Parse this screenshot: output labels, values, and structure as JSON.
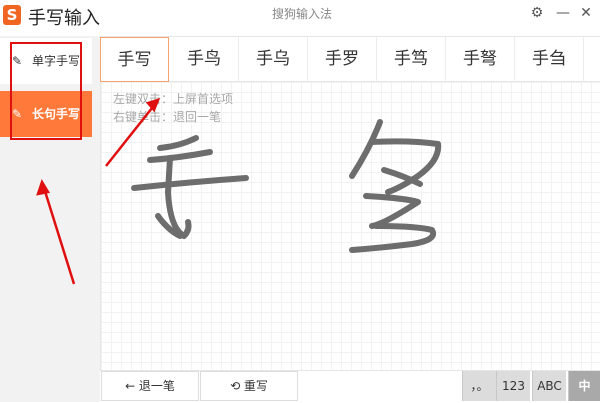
{
  "titlebar": {
    "logo_letter": "S",
    "app_title": "手写输入",
    "ime_name": "搜狗输入法",
    "settings_icon": "gear-icon",
    "minimize_icon": "minimize-icon",
    "close_icon": "close-icon"
  },
  "sidebar": {
    "items": [
      {
        "label": "单字手写",
        "icon": "pencil-icon",
        "active": false
      },
      {
        "label": "长句手写",
        "icon": "pencil-icon",
        "active": true
      }
    ]
  },
  "candidates": [
    "手写",
    "手鸟",
    "手乌",
    "手罗",
    "手笃",
    "手弩",
    "手刍"
  ],
  "board": {
    "hint_left": "左键双击：上屏首选项",
    "hint_right": "右键单击：退回一笔"
  },
  "toolbar": {
    "undo_label": "← 退一笔",
    "rewrite_label": "⟲ 重写",
    "punct_label": "，。",
    "num_label": "123",
    "abc_label": "ABC",
    "cn_label": "中"
  },
  "colors": {
    "accent": "#ff7a3a",
    "annotation": "#e01010",
    "ink": "#6d6d6d"
  }
}
